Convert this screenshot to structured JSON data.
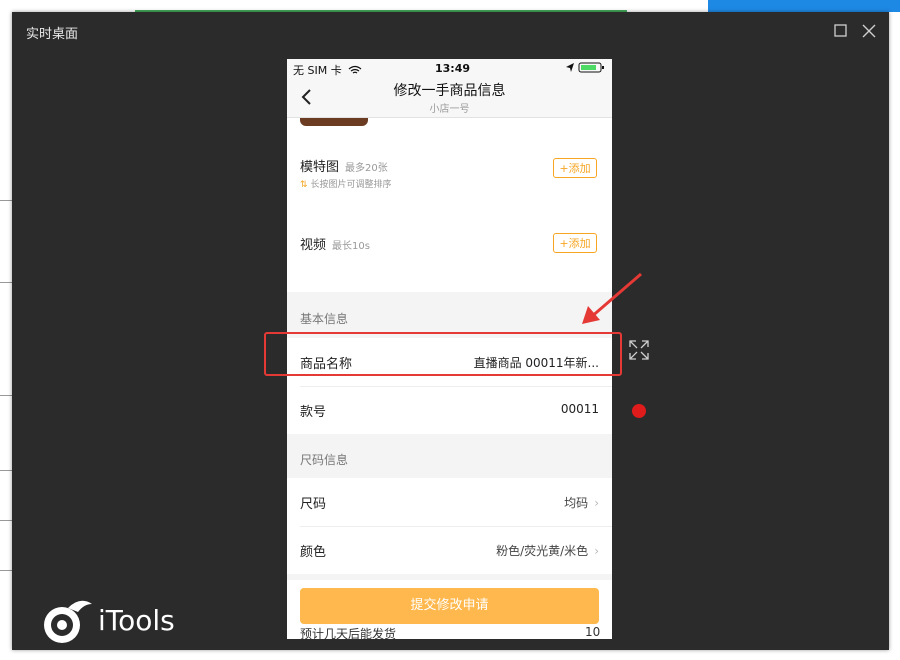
{
  "window": {
    "title": "实时桌面"
  },
  "phone": {
    "status_bar": {
      "carrier": "无 SIM 卡",
      "time": "13:49"
    },
    "nav": {
      "title": "修改一手商品信息",
      "subtitle": "小店一号"
    },
    "media": {
      "model_images": {
        "label": "模特图",
        "hint": "最多20张",
        "sub_hint": "长按图片可调整排序",
        "add_label": "+添加"
      },
      "video": {
        "label": "视频",
        "hint": "最长10s",
        "add_label": "+添加"
      }
    },
    "basic_info": {
      "section_label": "基本信息",
      "product_name_label": "商品名称",
      "product_name_value": "直播商品 00011年新...",
      "style_no_label": "款号",
      "style_no_value": "00011"
    },
    "size_info": {
      "section_label": "尺码信息",
      "size_label": "尺码",
      "size_value": "均码",
      "color_label": "颜色",
      "color_value": "粉色/荧光黄/米色"
    },
    "submit_label": "提交修改申请",
    "partial_row_label": "预计几天后能发货",
    "partial_row_value": "10"
  },
  "branding": {
    "logo_text": "iTools"
  },
  "colors": {
    "accent": "#f6a623",
    "submit": "#ffb84d",
    "annotation": "#e53935",
    "window_bg": "#2b2b2b"
  }
}
